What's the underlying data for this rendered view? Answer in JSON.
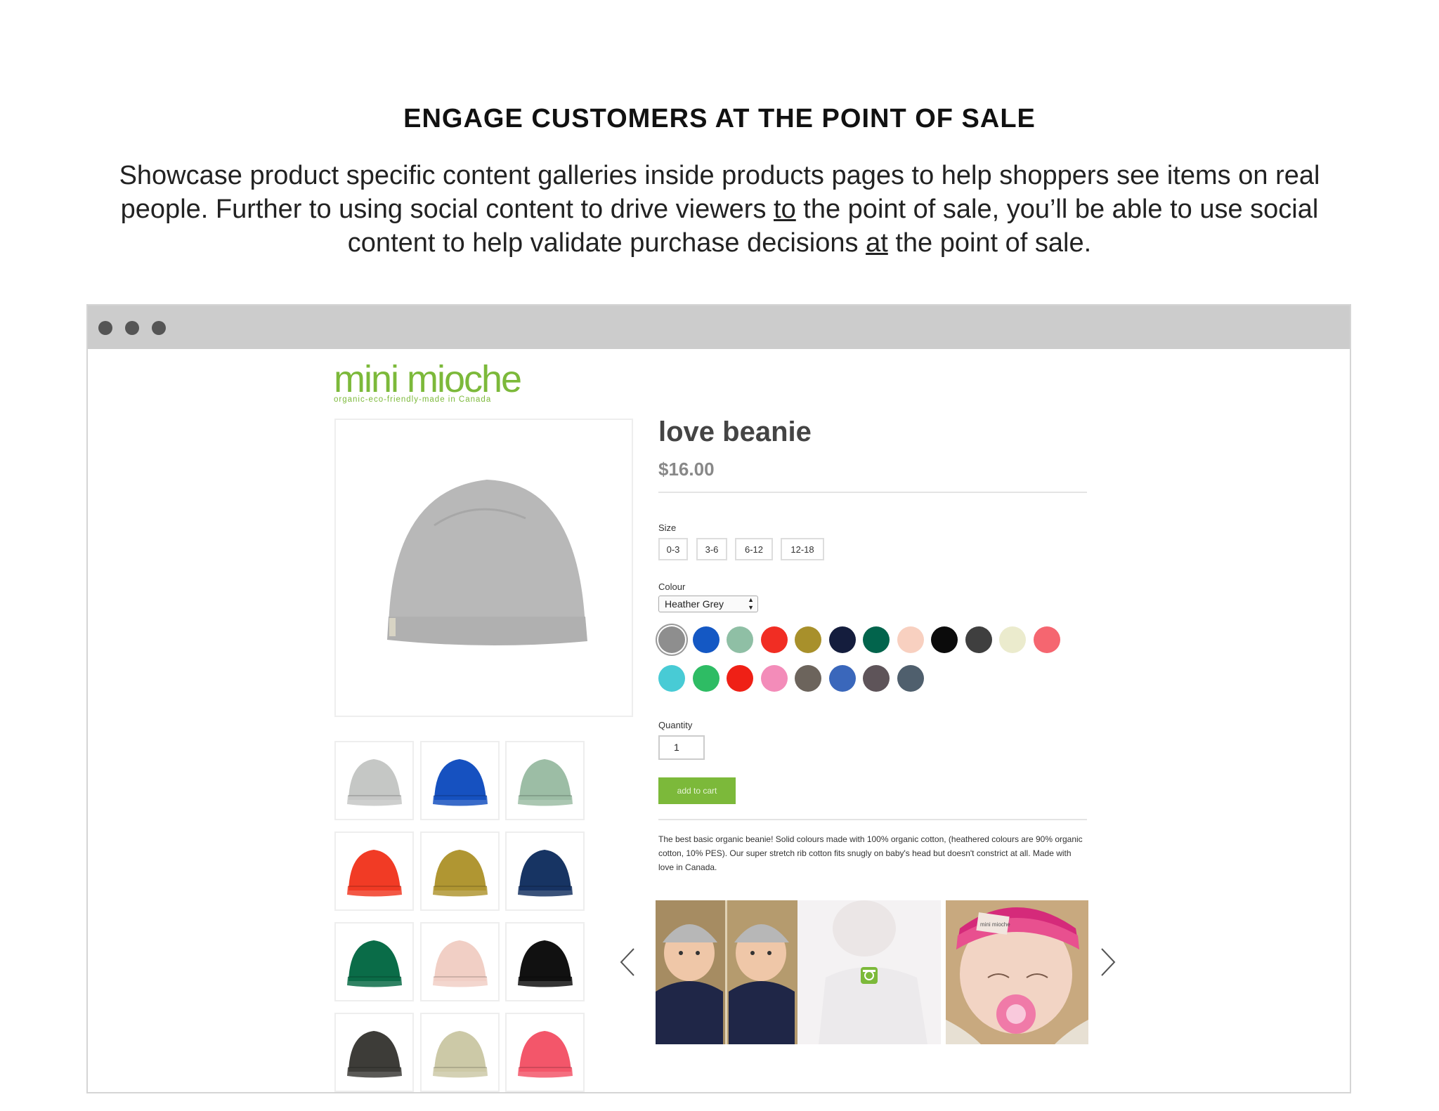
{
  "heading": "ENGAGE CUSTOMERS AT THE POINT OF SALE",
  "intro": {
    "part1": "Showcase product specific content galleries inside products pages to help shoppers see items on real people. Further to using social content to drive viewers ",
    "em1": "to",
    "part2": " the point of sale, you’ll be able to use social content to help validate purchase decisions ",
    "em2": "at",
    "part3": " the point of sale."
  },
  "store": {
    "logo_main": "mini mioche",
    "logo_tagline": "organic-eco-friendly-made in Canada",
    "product_name": "love beanie",
    "price": "$16.00",
    "size_label": "Size",
    "sizes": [
      "0-3",
      "3-6",
      "6-12",
      "12-18"
    ],
    "colour_label": "Colour",
    "colour_selected": "Heather Grey",
    "swatch_colors": [
      "#8e8e8e",
      "#1458c4",
      "#8fbfa5",
      "#f12d23",
      "#a8902b",
      "#141d3d",
      "#02644c",
      "#f8d0c0",
      "#0b0b0b",
      "#3f3f3f",
      "#ebebcd",
      "#f56670",
      "#48cbd5",
      "#2ebc64",
      "#ef2016",
      "#f38cb9",
      "#6c645c",
      "#3a67bb",
      "#5e5459",
      "#4f5f6d"
    ],
    "thumb_colors": [
      "#c5c7c5",
      "#1651c0",
      "#9cbda5",
      "#f13b25",
      "#b09632",
      "#173463",
      "#0a6c48",
      "#f1cfc5",
      "#111111",
      "#3d3c38",
      "#ccc9a7",
      "#f3566a"
    ],
    "quantity_label": "Quantity",
    "quantity_value": "1",
    "add_to_cart": "add to cart",
    "description": "The best basic organic beanie!  Solid colours made with 100% organic cotton, (heathered colours are 90% organic cotton, 10% PES). Our super stretch rib cotton fits snugly on baby's head but doesn't constrict at all. Made with love in Canada.",
    "photo_tag": "mini mioche"
  },
  "colors": {
    "brand_green": "#7cb93a",
    "chrome": "#cccccc"
  }
}
